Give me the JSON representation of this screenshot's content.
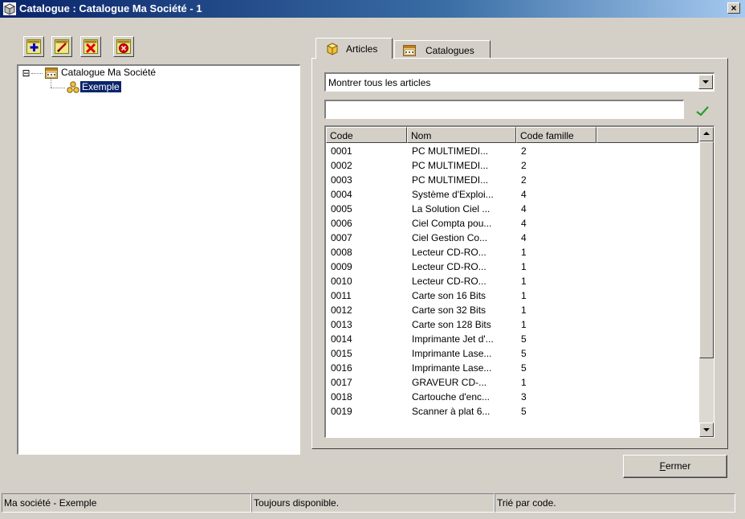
{
  "window": {
    "title": "Catalogue : Catalogue Ma Société - 1",
    "close_glyph": "×"
  },
  "toolbar": {
    "add_icon": "plus-icon",
    "edit_icon": "pencil-icon",
    "delete_icon": "red-x-icon",
    "remove_icon": "circle-x-icon"
  },
  "tree": {
    "expander": "⊟",
    "root_label": "Catalogue Ma Société",
    "child_label": "Exemple"
  },
  "tabs": [
    {
      "label": "Articles",
      "icon": "cube-icon"
    },
    {
      "label": "Catalogues",
      "icon": "catalogue-icon"
    }
  ],
  "filter": {
    "combo_value": "Montrer tous les articles",
    "search_value": ""
  },
  "list": {
    "columns": [
      "Code",
      "Nom",
      "Code famille",
      ""
    ],
    "rows": [
      [
        "0001",
        "PC MULTIMEDI...",
        "2"
      ],
      [
        "0002",
        "PC MULTIMEDI...",
        "2"
      ],
      [
        "0003",
        "PC MULTIMEDI...",
        "2"
      ],
      [
        "0004",
        "Système d'Exploi...",
        "4"
      ],
      [
        "0005",
        "La Solution Ciel ...",
        "4"
      ],
      [
        "0006",
        "Ciel Compta pou...",
        "4"
      ],
      [
        "0007",
        "Ciel Gestion Co...",
        "4"
      ],
      [
        "0008",
        "Lecteur CD-RO...",
        "1"
      ],
      [
        "0009",
        "Lecteur CD-RO...",
        "1"
      ],
      [
        "0010",
        "Lecteur CD-RO...",
        "1"
      ],
      [
        "0011",
        "Carte son 16 Bits",
        "1"
      ],
      [
        "0012",
        "Carte son 32 Bits",
        "1"
      ],
      [
        "0013",
        "Carte son 128 Bits",
        "1"
      ],
      [
        "0014",
        "Imprimante Jet d'...",
        "5"
      ],
      [
        "0015",
        "Imprimante Lase...",
        "5"
      ],
      [
        "0016",
        "Imprimante Lase...",
        "5"
      ],
      [
        "0017",
        "GRAVEUR CD-...",
        "1"
      ],
      [
        "0018",
        "Cartouche d'enc...",
        "3"
      ],
      [
        "0019",
        "Scanner à plat 6...",
        "5"
      ]
    ]
  },
  "buttons": {
    "close_first_letter": "F",
    "close_rest": "ermer"
  },
  "status": {
    "company": "Ma société - Exemple",
    "availability": "Toujours disponible.",
    "sort": "Trié par code."
  },
  "colors": {
    "face": "#d4d0c8",
    "titlebar_start": "#0a246a",
    "titlebar_end": "#a6caf0",
    "selection": "#0a246a"
  }
}
